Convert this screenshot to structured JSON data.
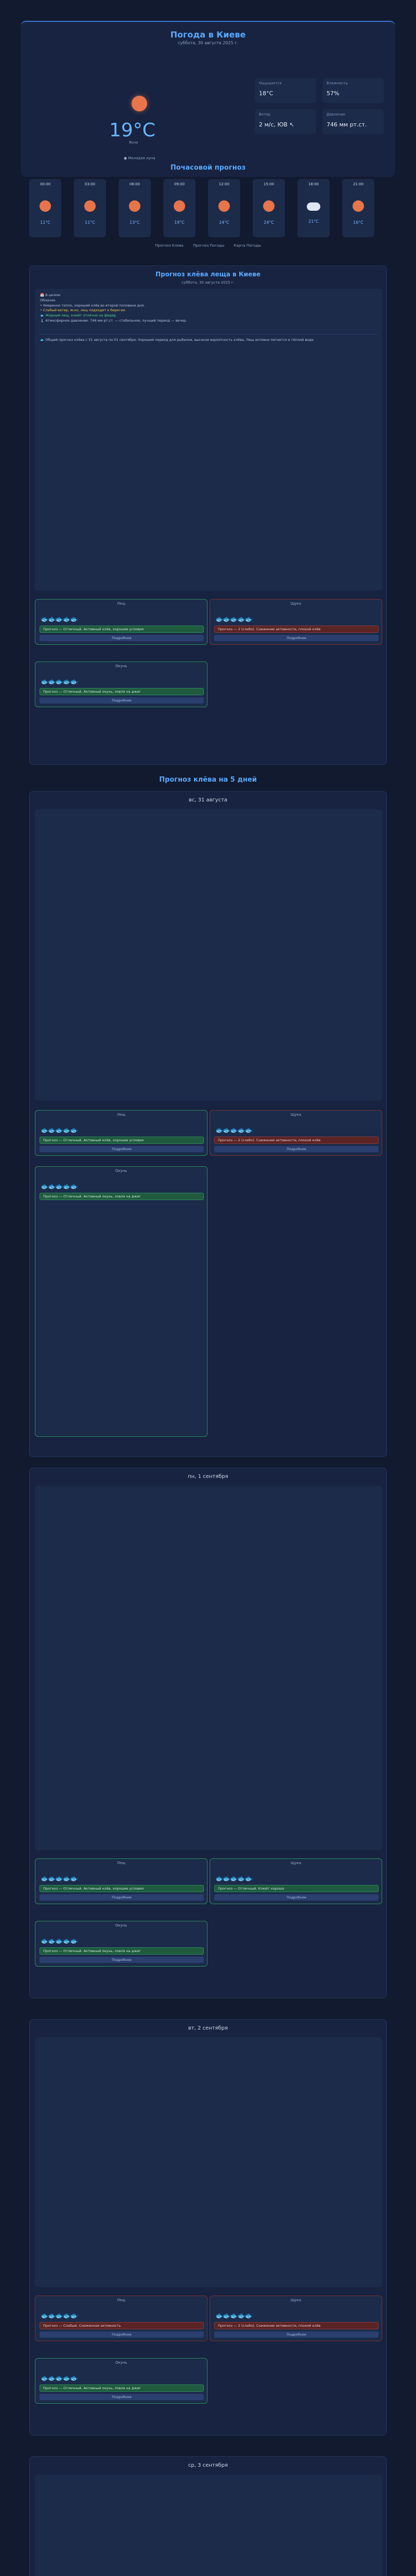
{
  "header": {
    "title": "Погода в Киеве",
    "date": "суббота, 30 августа 2025 г.",
    "temperature": "19°C",
    "feels": "Ясно",
    "moon": "Молодая луна",
    "stats": [
      {
        "label": "Ощущается",
        "value": "18°C"
      },
      {
        "label": "Влажность",
        "value": "57%"
      },
      {
        "label": "Ветер",
        "value": "2 м/с, ЮВ ↖"
      },
      {
        "label": "Давление",
        "value": "746 мм рт.ст."
      }
    ]
  },
  "hourly": {
    "title": "Почасовой прогноз",
    "items": [
      {
        "time": "00:00",
        "temp": "11°C",
        "icon": "sun-icon"
      },
      {
        "time": "03:00",
        "temp": "11°C",
        "icon": "sun-icon"
      },
      {
        "time": "06:00",
        "temp": "13°C",
        "icon": "sun-icon"
      },
      {
        "time": "09:00",
        "temp": "19°C",
        "icon": "sun-icon"
      },
      {
        "time": "12:00",
        "temp": "24°C",
        "icon": "sun-icon"
      },
      {
        "time": "15:00",
        "temp": "24°C",
        "icon": "sun-icon"
      },
      {
        "time": "18:00",
        "temp": "21°C",
        "icon": "cloud-icon"
      },
      {
        "time": "21:00",
        "temp": "16°C",
        "icon": "sun-icon"
      }
    ]
  },
  "tabs": [
    "Прогноз Клева",
    "Прогноз Погоды",
    "Карта Погоды"
  ],
  "today": {
    "title": "Прогноз клёва леща в Киеве",
    "date": "суббота, 30 августа 2025 г.",
    "analysis": [
      "📅 В целом:",
      "Облачно",
      "• Умеренно тепло, хороший клёв во второй половине дня.",
      "• Слабый ветер, ясно, лещ подходит к берегам.",
      "🐟 Жорный лещ, клюёт отлично на фидер.",
      "🌡 Атмосферное давление: 746 мм рт.ст. — стабильное, лучший период — вечер."
    ],
    "general": "🐟 Общий прогноз клёва с 31 августа по 01 сентября: Хороший период для рыбалки, высокая вероятность клёва. Лещ активно питается в тёплой воде.",
    "bites": [
      {
        "species": "Лещ",
        "label": "Прогноз — Отличный. Активный клёв, хорошие условия",
        "good": true
      },
      {
        "species": "Щука",
        "label": "Прогноз — 2 (слабо). Снижение активности, плохой клёв",
        "good": false
      },
      {
        "species": "Окунь",
        "label": "Прогноз — Отличный. Активный окунь, ловля на джиг",
        "good": true
      }
    ],
    "details_button": "Подробнее"
  },
  "week": {
    "title": "Прогноз клёва на 5 дней",
    "days": [
      {
        "date": "вс, 31 августа"
      },
      {
        "date": "пн, 1 сентября"
      },
      {
        "date": "вт, 2 сентября"
      },
      {
        "date": "ср, 3 сентября"
      }
    ]
  },
  "colors": {
    "accent": "#5aa9ff",
    "good": "#58d68d",
    "bad": "#e87474",
    "bg": "#111a2e"
  }
}
